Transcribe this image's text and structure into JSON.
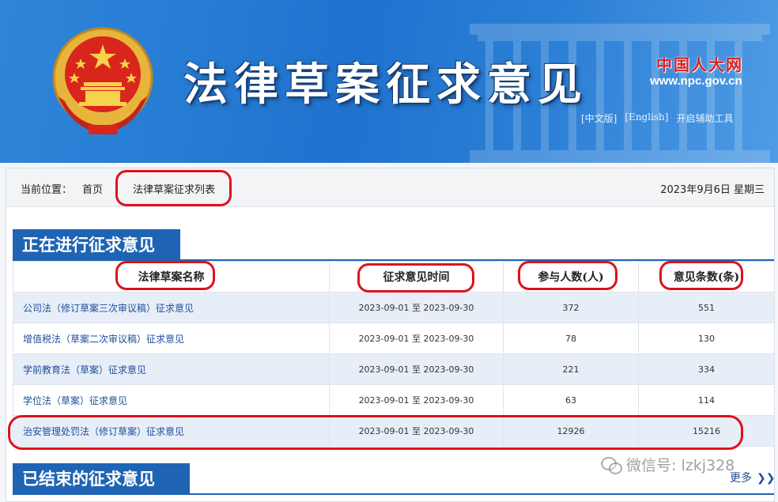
{
  "banner": {
    "title": "法律草案征求意见",
    "logo_text": "中国人大网",
    "logo_url": "www.npc.gov.cn",
    "links": [
      "[中文版]",
      "[English]",
      "开启辅助工具"
    ]
  },
  "breadcrumb": {
    "label": "当前位置：",
    "home": "首页",
    "current": "法律草案征求列表",
    "date": "2023年9月6日  星期三"
  },
  "active_section": {
    "title": "正在进行征求意见",
    "columns": [
      "法律草案名称",
      "征求意见时间",
      "参与人数(人)",
      "意见条数(条)"
    ],
    "rows": [
      {
        "name": "公司法（修订草案三次审议稿）征求意见",
        "time": "2023-09-01  至  2023-09-30",
        "people": "372",
        "count": "551"
      },
      {
        "name": "增值税法（草案二次审议稿）征求意见",
        "time": "2023-09-01  至  2023-09-30",
        "people": "78",
        "count": "130"
      },
      {
        "name": "学前教育法（草案）征求意见",
        "time": "2023-09-01  至  2023-09-30",
        "people": "221",
        "count": "334"
      },
      {
        "name": "学位法（草案）征求意见",
        "time": "2023-09-01  至  2023-09-30",
        "people": "63",
        "count": "114"
      },
      {
        "name": "治安管理处罚法（修订草案）征求意见",
        "time": "2023-09-01  至  2023-09-30",
        "people": "12926",
        "count": "15216"
      }
    ]
  },
  "closed_section": {
    "title": "已结束的征求意见",
    "more": "更多"
  },
  "watermark": "微信号: lzkj328",
  "colors": {
    "banner_blue": "#1f73cf",
    "section_blue": "#1f64b4",
    "annotation_red": "#e0101c",
    "link_blue": "#1f4e9a"
  }
}
